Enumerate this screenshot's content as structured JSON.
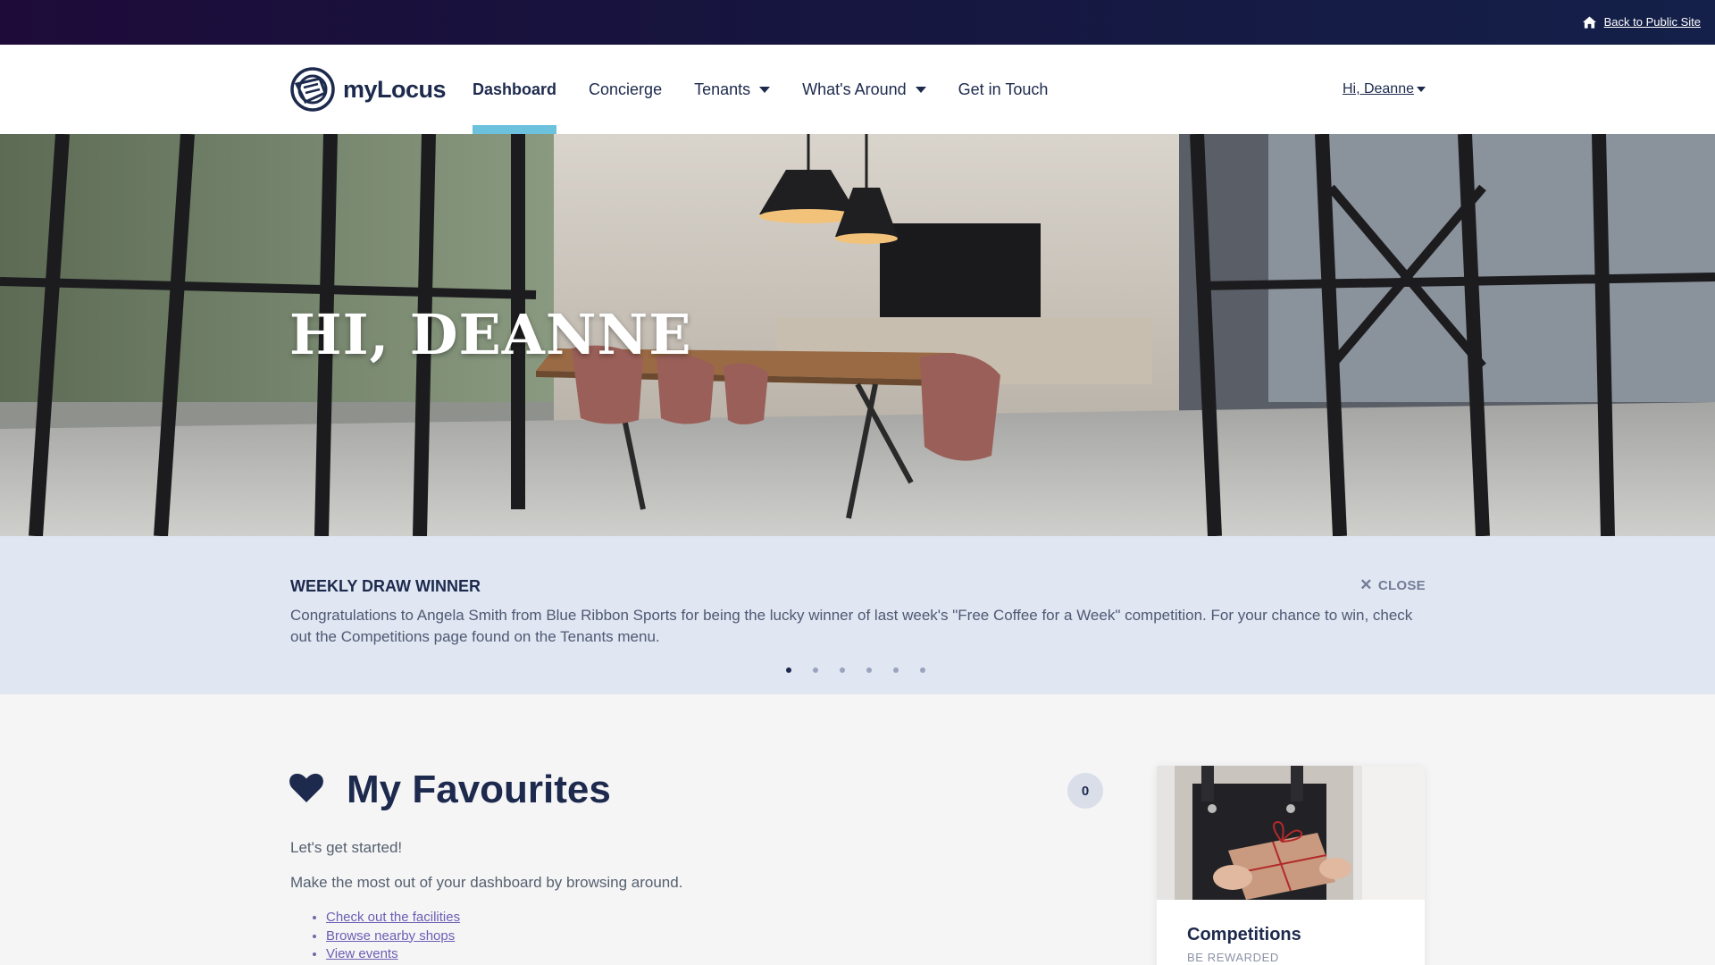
{
  "topbar": {
    "back_link": "Back to Public Site",
    "home_icon": "home-icon"
  },
  "nav": {
    "logo_text": "myLocus",
    "items": [
      {
        "label": "Dashboard",
        "active": true,
        "dropdown": false
      },
      {
        "label": "Concierge",
        "active": false,
        "dropdown": false
      },
      {
        "label": "Tenants",
        "active": false,
        "dropdown": true
      },
      {
        "label": "What's Around",
        "active": false,
        "dropdown": true
      },
      {
        "label": "Get in Touch",
        "active": false,
        "dropdown": false
      }
    ],
    "user_menu": "Hi, Deanne"
  },
  "hero": {
    "title": "HI, DEANNE"
  },
  "announcement": {
    "title": "WEEKLY DRAW WINNER",
    "body": "Congratulations to Angela Smith from Blue Ribbon Sports for being the lucky winner of last week's \"Free Coffee for a Week\" competition. For your chance to win, check out the Competitions page found on the Tenants menu.",
    "close_label": "CLOSE",
    "slide_count": 6,
    "active_slide": 1
  },
  "favourites": {
    "title": "My Favourites",
    "count": "0",
    "intro": "Let's get started!",
    "description": "Make the most out of your dashboard by browsing around.",
    "links": [
      "Check out the facilities",
      "Browse nearby shops",
      "View events"
    ]
  },
  "card": {
    "title": "Competitions",
    "subtitle": "BE REWARDED"
  },
  "colors": {
    "accent": "#6cc2dc",
    "navy": "#1d2a4d",
    "announce_bg": "#e0e6f2",
    "link": "#6b5fb3"
  }
}
